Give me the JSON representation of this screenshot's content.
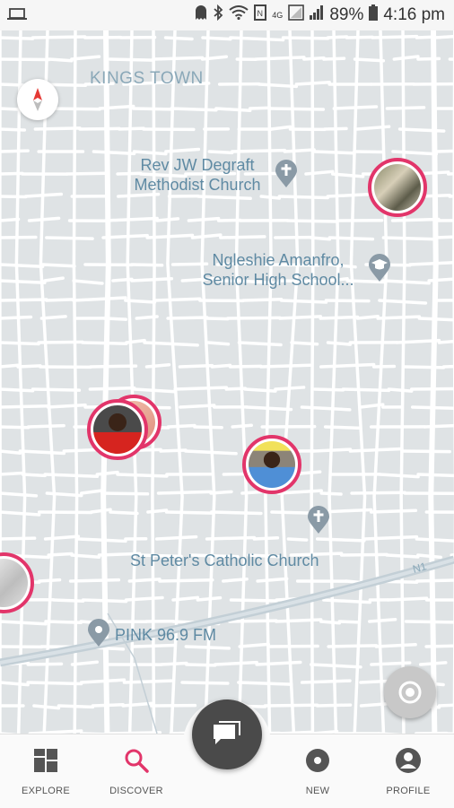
{
  "status_bar": {
    "battery_percent": "89%",
    "time": "4:16 pm",
    "network": "4G"
  },
  "map": {
    "area_label": "KINGS TOWN",
    "places": [
      {
        "name_line1": "Rev JW Degraft",
        "name_line2": "Methodist Church",
        "icon": "cross-icon"
      },
      {
        "name_line1": "Ngleshie Amanfro,",
        "name_line2": "Senior High School...",
        "icon": "graduation-cap-icon"
      },
      {
        "name": "St Peter's Catholic Church",
        "icon": "cross-icon"
      },
      {
        "name": "PINK 96.9 FM",
        "icon": "location-pin-icon"
      }
    ],
    "road_label": "N1"
  },
  "colors": {
    "accent": "#e2356a",
    "map_label": "#5f8aa3",
    "fab": "#4a4a4a"
  },
  "bottom_nav": {
    "items": [
      {
        "label": "EXPLORE",
        "icon": "grid-icon",
        "active": false
      },
      {
        "label": "DISCOVER",
        "icon": "search-icon",
        "active": true
      },
      {
        "label": "NEW",
        "icon": "record-icon",
        "active": false
      },
      {
        "label": "PROFILE",
        "icon": "person-icon",
        "active": false
      }
    ],
    "center_button_icon": "chat-icon"
  }
}
